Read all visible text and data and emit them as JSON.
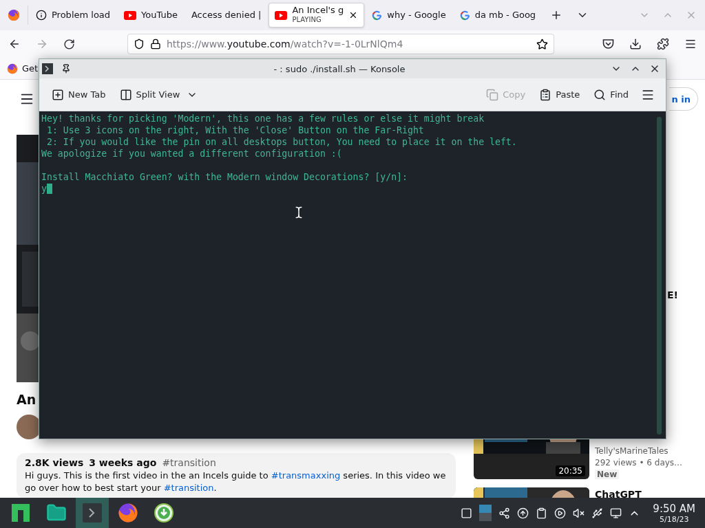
{
  "browser": {
    "tabs": [
      {
        "label": "Problem load",
        "selected": false
      },
      {
        "label": "YouTube",
        "selected": false
      },
      {
        "label": "Access denied |",
        "selected": false
      },
      {
        "label": "An Incel's g",
        "sublabel": "PLAYING",
        "selected": true
      },
      {
        "label": "why - Google",
        "selected": false
      },
      {
        "label": "da mb - Goog",
        "selected": false
      }
    ],
    "forward_disabled": true,
    "url": {
      "prefix": "https://www.",
      "domain": "youtube.com",
      "path": "/watch?v=-1-0LrNlQm4"
    },
    "bookmarks": [
      {
        "label": "Get"
      }
    ]
  },
  "youtube": {
    "sign_in": "n in",
    "side_text": "E!",
    "title": "An",
    "stats": [
      {
        "text": "2.8K views",
        "kind": "plain"
      },
      {
        "text": "3 weeks ago",
        "kind": "plain"
      },
      {
        "text": "#transition",
        "kind": "tag"
      }
    ],
    "description": [
      {
        "text": "Hi guys. This is the first video in the an Incels guide to ",
        "kind": "plain"
      },
      {
        "text": "#transmaxxing",
        "kind": "link"
      },
      {
        "text": " series. In this video we go over how to best start your ",
        "kind": "plain"
      },
      {
        "text": "#transition",
        "kind": "link"
      },
      {
        "text": ".",
        "kind": "plain"
      }
    ],
    "videos": [
      {
        "duration": "20:35",
        "channel": "Telly'sMarineTales",
        "meta": "292 views  • 6 days…",
        "badge": "New"
      },
      {
        "title": "ChatGPT"
      }
    ]
  },
  "konsole": {
    "title": "- : sudo ./install.sh — Konsole",
    "toolbar": [
      {
        "label": "New Tab",
        "disabled": false
      },
      {
        "label": "Split View",
        "disabled": false
      },
      {
        "label": "Copy",
        "disabled": true
      },
      {
        "label": "Paste",
        "disabled": false
      },
      {
        "label": "Find",
        "disabled": false
      }
    ],
    "output": [
      [
        "Hey! thanks for picking 'Modern', this one has a few rules or else it might break",
        " 1: Use 3 icons on the right, With the 'Close' Button on the Far-Right",
        " 2: If you would like the pin on all desktops button, You need to place it on the left.",
        "We apologize if you wanted a different configuration :("
      ],
      [
        "Install Macchiato Green? with the Modern window Decorations? [y/n]:"
      ]
    ],
    "input": "y"
  },
  "taskbar": {
    "apps": [
      {
        "selected": false
      },
      {
        "selected": false
      },
      {
        "selected": true
      },
      {
        "selected": false
      },
      {
        "selected": false
      }
    ],
    "time": "9:50 AM",
    "date": "5/18/23"
  }
}
